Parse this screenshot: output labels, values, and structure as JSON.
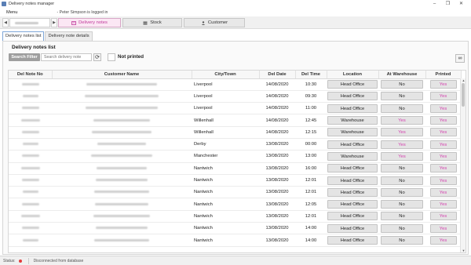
{
  "window": {
    "title": "Delivery notes manager",
    "controls": [
      "–",
      "❐",
      "✕"
    ]
  },
  "menu": {
    "label": "Menu",
    "logged_in": "- Peter Simpson is logged in"
  },
  "navbar": {
    "delivery_notes": "Delivery notes",
    "stock": "Stock",
    "customer": "Customer",
    "accent": "#c0389a"
  },
  "tabs": [
    {
      "label": "Delivery notes list",
      "active": true
    },
    {
      "label": "Delivery note details",
      "active": false
    }
  ],
  "panel": {
    "title": "Delivery notes list",
    "search_button": "Search Filter",
    "search_placeholder": "Search delivery note",
    "not_printed_label": "Not printed"
  },
  "table": {
    "columns": [
      "Del Note No",
      "Customer Name",
      "City/Town",
      "Del Date",
      "Del Time",
      "Location",
      "At Warehouse",
      "Printed"
    ],
    "rows": [
      {
        "city": "Liverpool",
        "date": "14/08/2020",
        "time": "10:30",
        "location": "Head Office",
        "at_warehouse": "No",
        "printed": "Yes"
      },
      {
        "city": "Liverpool",
        "date": "14/08/2020",
        "time": "09:30",
        "location": "Head Office",
        "at_warehouse": "No",
        "printed": "Yes"
      },
      {
        "city": "Liverpool",
        "date": "14/08/2020",
        "time": "11:00",
        "location": "Head Office",
        "at_warehouse": "No",
        "printed": "Yes"
      },
      {
        "city": "Willenhall",
        "date": "14/08/2020",
        "time": "12:45",
        "location": "Warehouse",
        "at_warehouse": "Yes",
        "printed": "Yes"
      },
      {
        "city": "Willenhall",
        "date": "14/08/2020",
        "time": "12:15",
        "location": "Warehouse",
        "at_warehouse": "Yes",
        "printed": "Yes"
      },
      {
        "city": "Derby",
        "date": "13/08/2020",
        "time": "00:00",
        "location": "Head Office",
        "at_warehouse": "Yes",
        "printed": "Yes"
      },
      {
        "city": "Manchester",
        "date": "13/08/2020",
        "time": "13:00",
        "location": "Warehouse",
        "at_warehouse": "Yes",
        "printed": "Yes"
      },
      {
        "city": "Nantwich",
        "date": "13/08/2020",
        "time": "16:00",
        "location": "Head Office",
        "at_warehouse": "No",
        "printed": "Yes"
      },
      {
        "city": "Nantwich",
        "date": "13/08/2020",
        "time": "12:01",
        "location": "Head Office",
        "at_warehouse": "No",
        "printed": "Yes"
      },
      {
        "city": "Nantwich",
        "date": "13/08/2020",
        "time": "12:01",
        "location": "Head Office",
        "at_warehouse": "No",
        "printed": "Yes"
      },
      {
        "city": "Nantwich",
        "date": "13/08/2020",
        "time": "12:05",
        "location": "Head Office",
        "at_warehouse": "No",
        "printed": "Yes"
      },
      {
        "city": "Nantwich",
        "date": "13/08/2020",
        "time": "12:01",
        "location": "Head Office",
        "at_warehouse": "No",
        "printed": "Yes"
      },
      {
        "city": "Nantwich",
        "date": "13/08/2020",
        "time": "14:00",
        "location": "Head Office",
        "at_warehouse": "No",
        "printed": "Yes"
      },
      {
        "city": "Nantwich",
        "date": "13/08/2020",
        "time": "14:00",
        "location": "Head Office",
        "at_warehouse": "No",
        "printed": "Yes"
      }
    ]
  },
  "status": {
    "label": "Status:",
    "indicator_color": "#e23b3b",
    "message": "Disconnected from database"
  }
}
